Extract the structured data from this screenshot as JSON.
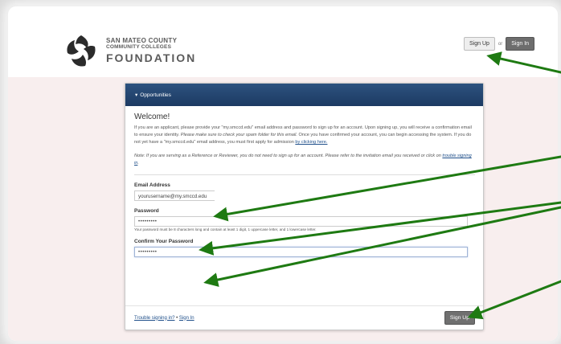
{
  "logo": {
    "line1": "SAN MATEO COUNTY",
    "line2": "COMMUNITY COLLEGES",
    "line3": "FOUNDATION"
  },
  "top_auth": {
    "signup_label": "Sign Up",
    "or_label": "or",
    "signin_label": "Sign In"
  },
  "panel": {
    "header_arrow": "▾",
    "header_label": "Opportunities",
    "welcome": "Welcome!",
    "para1_a": "If you are an applicant, please provide your \"my.smccd.edu\" email address and password to sign up for an account. Upon signing up, you will receive a confirmation email to ensure your identity. ",
    "para1_em": "Please make sure to check your spam folder for this email.",
    "para1_b": " Once you have confirmed your account, you can begin accessing the system. If you do not yet have a \"my.smccd.edu\" email address, you must first apply for admission ",
    "para1_link": "by clicking here.",
    "note_a": "Note: If you are serving as a Reference or Reviewer, you do not need to sign up for an account. Please refer to the invitation email you received or click on ",
    "note_link": "trouble signing in",
    "note_b": ".",
    "email_label": "Email Address",
    "email_value": "yourusername@my.smccd.edu",
    "password_label": "Password",
    "password_value": "•••••••••",
    "password_hint": "Your password must be 8 characters long and contain at least 1 digit, 1 uppercase letter, and 1 lowercase letter.",
    "confirm_label": "Confirm Your Password",
    "confirm_value": "•••••••••",
    "trouble_link": "Trouble signing in?",
    "bullet": " • ",
    "signin_link": "Sign In",
    "signup_button": "Sign Up"
  },
  "colors": {
    "panel_header": "#1f4068",
    "arrow": "#1e7a12",
    "band": "#f8eeee"
  }
}
